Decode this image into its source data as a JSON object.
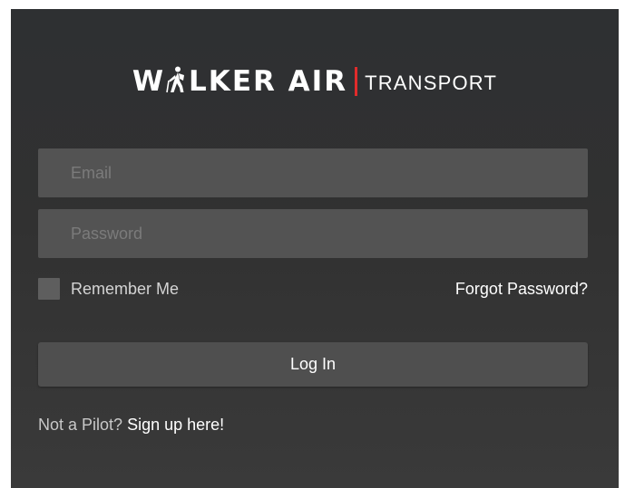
{
  "logo": {
    "part1": "W",
    "part2": "LKER AIR",
    "sub": "TRANSPORT",
    "icon": "hiker-icon",
    "divider_color": "#e12b2b"
  },
  "form": {
    "email_placeholder": "Email",
    "email_value": "",
    "password_placeholder": "Password",
    "password_value": "",
    "remember_label": "Remember Me",
    "remember_checked": false,
    "forgot_label": "Forgot Password?",
    "login_label": "Log In"
  },
  "footer": {
    "prompt": "Not a Pilot?",
    "signup_label": "Sign up here!"
  },
  "colors": {
    "background": "#313131",
    "field": "#535353",
    "button": "#4f4f4f",
    "accent": "#e12b2b"
  }
}
